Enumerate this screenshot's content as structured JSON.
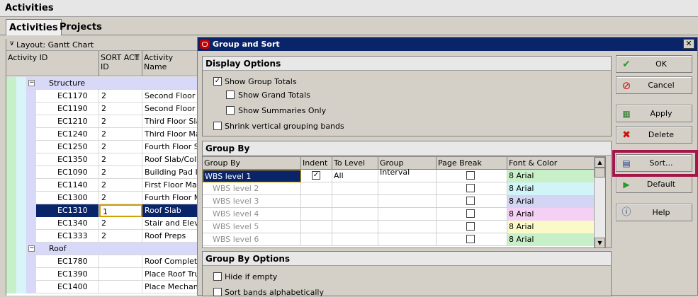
{
  "app": {
    "title": "Activities"
  },
  "tabs": [
    {
      "label": "Activities"
    },
    {
      "label": "Projects"
    }
  ],
  "grid": {
    "layout_label": "Layout: Gantt Chart",
    "headers": {
      "activity_id": "Activity ID",
      "sort_act_id": "SORT ACT ID",
      "activity_name": "Activity Name"
    },
    "group_structure": "Structure",
    "group_roof": "Roof",
    "rows": [
      {
        "id": "EC1170",
        "sort": "2",
        "name": "Second Floor S"
      },
      {
        "id": "EC1190",
        "sort": "2",
        "name": "Second Floor M"
      },
      {
        "id": "EC1210",
        "sort": "2",
        "name": "Third Floor Slab"
      },
      {
        "id": "EC1240",
        "sort": "2",
        "name": "Third Floor Mas"
      },
      {
        "id": "EC1250",
        "sort": "2",
        "name": "Fourth Floor Sla"
      },
      {
        "id": "EC1350",
        "sort": "2",
        "name": "Roof Slab/Colla"
      },
      {
        "id": "EC1090",
        "sort": "2",
        "name": "Building Pad In"
      },
      {
        "id": "EC1140",
        "sort": "2",
        "name": "First Floor Maso"
      },
      {
        "id": "EC1300",
        "sort": "2",
        "name": "Fourth Floor Ma"
      },
      {
        "id": "EC1310",
        "sort": "1",
        "name": "Roof Slab"
      },
      {
        "id": "EC1340",
        "sort": "2",
        "name": "Stair and Eleva"
      },
      {
        "id": "EC1333",
        "sort": "2",
        "name": "Roof Preps"
      }
    ],
    "roof_rows": [
      {
        "id": "EC1780",
        "sort": "",
        "name": "Roof Complete"
      },
      {
        "id": "EC1390",
        "sort": "",
        "name": "Place Roof Tru"
      },
      {
        "id": "EC1400",
        "sort": "",
        "name": "Place Mechani"
      }
    ]
  },
  "dialog": {
    "title": "Group and Sort",
    "display_options": {
      "heading": "Display Options",
      "show_group_totals": "Show Group Totals",
      "show_grand_totals": "Show Grand Totals",
      "show_summaries_only": "Show Summaries Only",
      "shrink_bands": "Shrink vertical grouping bands"
    },
    "group_by": {
      "heading": "Group By",
      "columns": [
        "Group By",
        "Indent",
        "To Level",
        "Group Interval",
        "Page Break",
        "Font & Color"
      ],
      "rows": [
        {
          "name": "WBS level 1",
          "indent": true,
          "to_level": "All",
          "font": "8 Arial",
          "color": "#c8f0c8"
        },
        {
          "name": "WBS level 2",
          "indent": false,
          "to_level": "",
          "font": "8 Arial",
          "color": "#d0f4f8"
        },
        {
          "name": "WBS level 3",
          "indent": false,
          "to_level": "",
          "font": "8 Arial",
          "color": "#d4d4f4"
        },
        {
          "name": "WBS level 4",
          "indent": false,
          "to_level": "",
          "font": "8 Arial",
          "color": "#f4d0f4"
        },
        {
          "name": "WBS level 5",
          "indent": false,
          "to_level": "",
          "font": "8 Arial",
          "color": "#fafac8"
        },
        {
          "name": "WBS level 6",
          "indent": false,
          "to_level": "",
          "font": "8 Arial",
          "color": "#c8f0c8"
        }
      ]
    },
    "group_by_options": {
      "heading": "Group By Options",
      "hide_if_empty": "Hide if empty",
      "sort_bands": "Sort bands alphabetically"
    },
    "buttons": {
      "ok": "OK",
      "cancel": "Cancel",
      "apply": "Apply",
      "delete": "Delete",
      "sort": "Sort...",
      "default": "Default",
      "help": "Help"
    }
  },
  "colors": {
    "selection": "#0a246a",
    "highlight": "#a3164a"
  }
}
